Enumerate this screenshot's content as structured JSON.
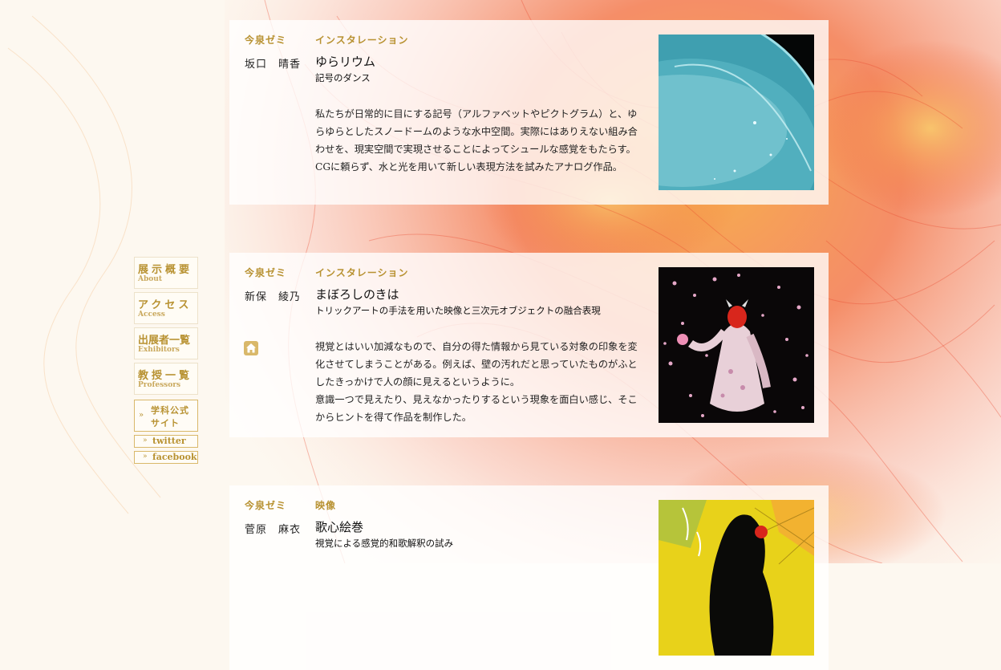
{
  "nav": {
    "about_ja": "展示概要",
    "about_en": "About",
    "access_ja": "アクセス",
    "access_en": "Access",
    "exhibitors_ja": "出展者一覧",
    "exhibitors_en": "Exhibitors",
    "professors_ja": "教授一覧",
    "professors_en": "Professors",
    "site_line1": "学科公式",
    "site_line2": "サイト",
    "twitter": "twitter",
    "facebook": "facebook",
    "chevron": "»"
  },
  "works": [
    {
      "zemi": "今泉ゼミ",
      "name": "坂口　晴香",
      "category": "インスタレーション",
      "title": "ゆらリウム",
      "subtitle": "記号のダンス",
      "description": [
        "私たちが日常的に目にする記号（アルファベットやピクトグラム）と、ゆらゆらとしたスノードームのような水中空間。実際にはありえない組み合わせを、現実空間で実現させることによってシュールな感覚をもたらす。CGに頼らず、水と光を用いて新しい表現方法を試みたアナログ作品。"
      ],
      "thumb_icon": "water-sphere-image"
    },
    {
      "zemi": "今泉ゼミ",
      "name": "新保　綾乃",
      "category": "インスタレーション",
      "title": "まぼろしのきは",
      "subtitle": "トリックアートの手法を用いた映像と三次元オブジェクトの融合表現",
      "description": [
        "視覚とはいい加減なもので、自分の得た情報から見ている対象の印象を変化させてしまうことがある。例えば、壁の汚れだと思っていたものがふとしたきっかけで人の顔に見えるというように。",
        "意識一つで見えたり、見えなかったりするという現象を面白い感じ、そこからヒントを得て作品を制作した。"
      ],
      "thumb_icon": "masked-figure-image",
      "home_icon": "home-icon"
    },
    {
      "zemi": "今泉ゼミ",
      "name": "菅原　麻衣",
      "category": "映像",
      "title": "歌心絵巻",
      "subtitle": "視覚による感覚的和歌解釈の試み",
      "thumb_icon": "silhouette-yellow-image"
    }
  ],
  "colors": {
    "gold": "#b89232",
    "swirl_red": "#f04a2a",
    "swirl_orange": "#f7a23a"
  }
}
